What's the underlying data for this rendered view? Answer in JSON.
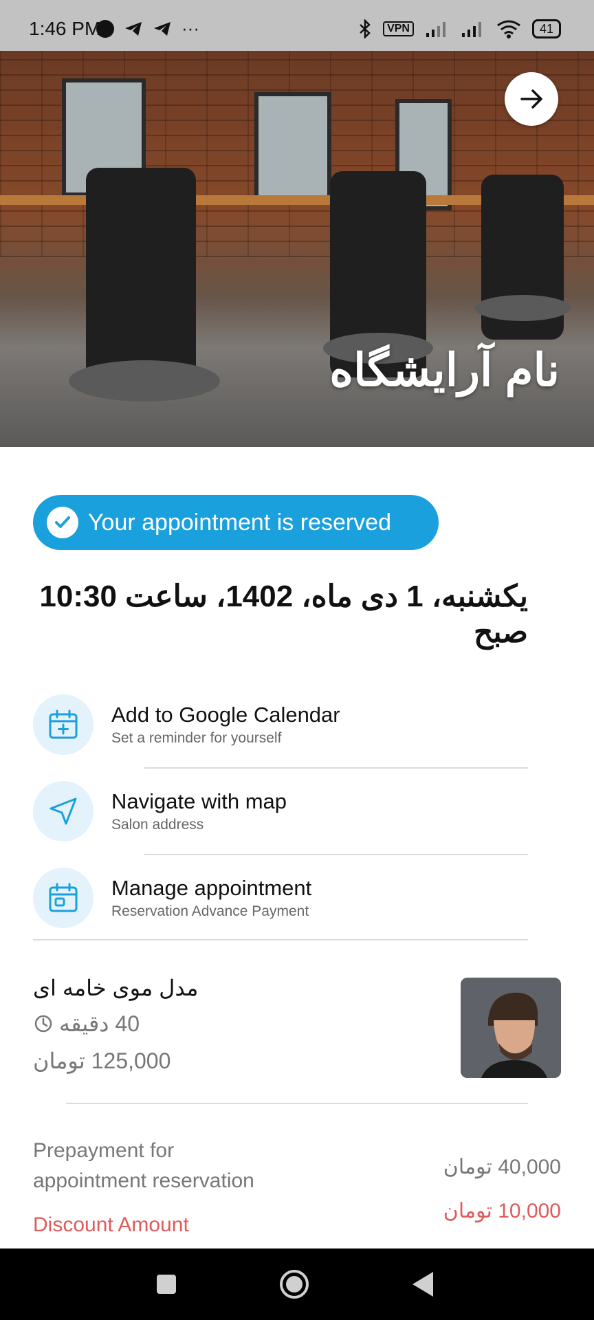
{
  "status_bar": {
    "time": "1:46 PM",
    "vpn": "VPN",
    "battery": "41"
  },
  "header": {
    "salon_name": "نام آرایشگاه"
  },
  "reservation": {
    "badge_text": "Your appointment is reserved",
    "datetime": "یکشنبه، 1 دی ماه، 1402، ساعت 10:30 صبح"
  },
  "actions": [
    {
      "title": "Add to Google Calendar",
      "subtitle": "Set a reminder for yourself",
      "icon": "calendar-plus-icon"
    },
    {
      "title": "Navigate with map",
      "subtitle": "Salon address",
      "icon": "navigation-arrow-icon"
    },
    {
      "title": "Manage appointment",
      "subtitle": "Reservation Advance Payment",
      "icon": "calendar-manage-icon"
    }
  ],
  "service": {
    "name": "مدل موی خامه ای",
    "duration": "40 دقیقه",
    "price": "125,000 تومان"
  },
  "payment": {
    "prepayment_label": "Prepayment for appointment reservation",
    "prepayment_value": "40,000 تومان",
    "discount_label": "Discount Amount",
    "discount_value": "10,000 تومان"
  },
  "colors": {
    "accent": "#1aa0dd",
    "discount": "#e05a5a",
    "icon_bg": "#e3f2fb"
  }
}
